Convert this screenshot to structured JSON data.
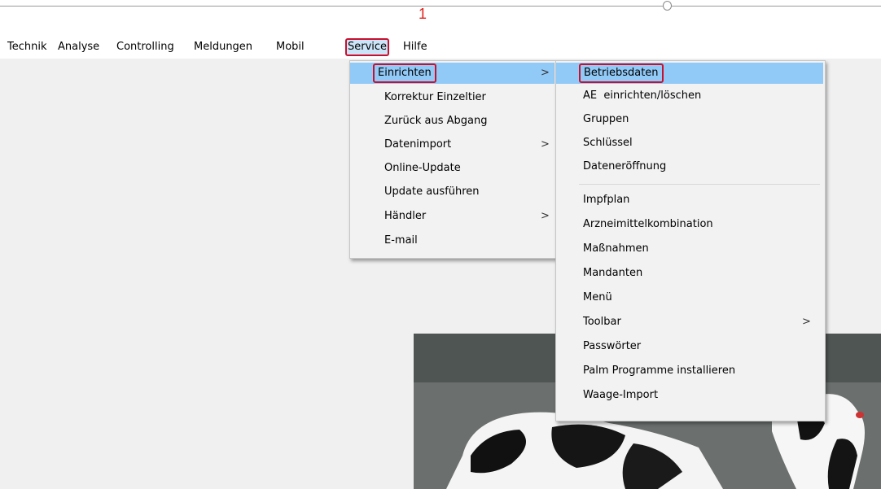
{
  "annotation": {
    "step_number": "1"
  },
  "menubar": {
    "items": [
      {
        "label": "Technik"
      },
      {
        "label": "Analyse"
      },
      {
        "label": "Controlling"
      },
      {
        "label": "Meldungen"
      },
      {
        "label": "Mobil"
      },
      {
        "label": "Service"
      },
      {
        "label": "Hilfe"
      }
    ]
  },
  "service_menu": {
    "items": [
      {
        "label": "Einrichten",
        "submenu": true,
        "highlighted": true
      },
      {
        "label": "Korrektur Einzeltier"
      },
      {
        "label": "Zurück aus Abgang"
      },
      {
        "label": "Datenimport",
        "submenu": true
      },
      {
        "label": "Online-Update"
      },
      {
        "label": "Update ausführen"
      },
      {
        "label": "Händler",
        "submenu": true
      },
      {
        "label": "E-mail"
      }
    ]
  },
  "einrichten_menu": {
    "items": [
      {
        "label": "Betriebsdaten",
        "highlighted": true
      },
      {
        "label": "AE  einrichten/löschen"
      },
      {
        "label": "Gruppen"
      },
      {
        "label": "Schlüssel"
      },
      {
        "label": "Dateneröffnung"
      },
      {
        "label": "Impfplan"
      },
      {
        "label": "Arzneimittelkombination"
      },
      {
        "label": "Maßnahmen"
      },
      {
        "label": "Mandanten"
      },
      {
        "label": "Menü"
      },
      {
        "label": "Toolbar",
        "submenu": true
      },
      {
        "label": "Passwörter"
      },
      {
        "label": "Palm Programme installieren"
      },
      {
        "label": "Waage-Import"
      }
    ]
  },
  "glyphs": {
    "submenu_arrow": ">"
  },
  "colors": {
    "highlight": "#91c9f7",
    "annotation_red": "#c8102e",
    "menu_background": "#f2f2f2"
  }
}
